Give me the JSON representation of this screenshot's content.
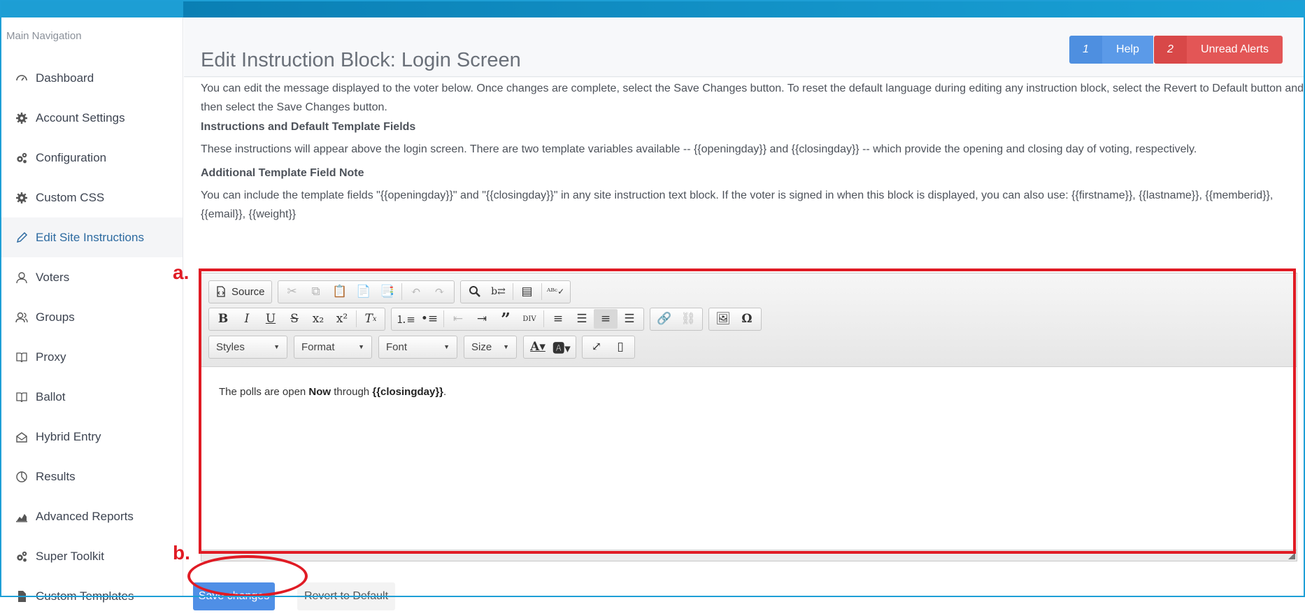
{
  "colors": {
    "accent": "#1e9fd6",
    "help": "#5b9ae8",
    "alert": "#e35656",
    "annotation": "#e01b24",
    "save": "#4f8fe6"
  },
  "sidebar": {
    "title": "Main Navigation",
    "items": [
      {
        "label": "Dashboard",
        "icon": "dashboard-icon"
      },
      {
        "label": "Account Settings",
        "icon": "gear-icon"
      },
      {
        "label": "Configuration",
        "icon": "gears-icon"
      },
      {
        "label": "Custom CSS",
        "icon": "gear-icon"
      },
      {
        "label": "Edit Site Instructions",
        "icon": "pencil-icon",
        "active": true
      },
      {
        "label": "Voters",
        "icon": "user-icon"
      },
      {
        "label": "Groups",
        "icon": "users-icon"
      },
      {
        "label": "Proxy",
        "icon": "book-icon"
      },
      {
        "label": "Ballot",
        "icon": "book-icon"
      },
      {
        "label": "Hybrid Entry",
        "icon": "envelope-icon"
      },
      {
        "label": "Results",
        "icon": "pie-chart-icon"
      },
      {
        "label": "Advanced Reports",
        "icon": "area-chart-icon"
      },
      {
        "label": "Super Toolkit",
        "icon": "gears-icon"
      },
      {
        "label": "Custom Templates",
        "icon": "file-icon"
      }
    ]
  },
  "header": {
    "title": "Edit Instruction Block: Login Screen",
    "help": {
      "count": "1",
      "label": "Help"
    },
    "alerts": {
      "count": "2",
      "label": "Unread Alerts"
    }
  },
  "content": {
    "intro": "You can edit the message displayed to the voter below.   Once changes are complete, select the Save Changes button. To reset the default language during editing any instruction block, select the Revert to Default button and then select the Save Changes button.",
    "section1_title": "Instructions and Default Template Fields",
    "section1_text": "These instructions will appear above the login screen. There are two template variables available -- {{openingday}} and {{closingday}} -- which provide the opening and closing day of voting, respectively.",
    "section2_title": "Additional Template Field Note",
    "section2_text": "You can include the template fields \"{{openingday}}\" and \"{{closingday}}\" in any site instruction text block. If the voter is signed in when this block is displayed, you can also use: {{firstname}}, {{lastname}}, {{memberid}}, {{email}}, {{weight}}"
  },
  "editor": {
    "source_label": "Source",
    "combos": {
      "styles": "Styles",
      "format": "Format",
      "font": "Font",
      "size": "Size"
    },
    "text": {
      "prefix": "The polls are open ",
      "bold1": "Now",
      "middle": " through ",
      "bold2": "{{closingday}}",
      "suffix": "."
    }
  },
  "buttons": {
    "save": "Save changes",
    "revert": "Revert to Default"
  },
  "annotations": {
    "a": "a.",
    "b": "b."
  }
}
